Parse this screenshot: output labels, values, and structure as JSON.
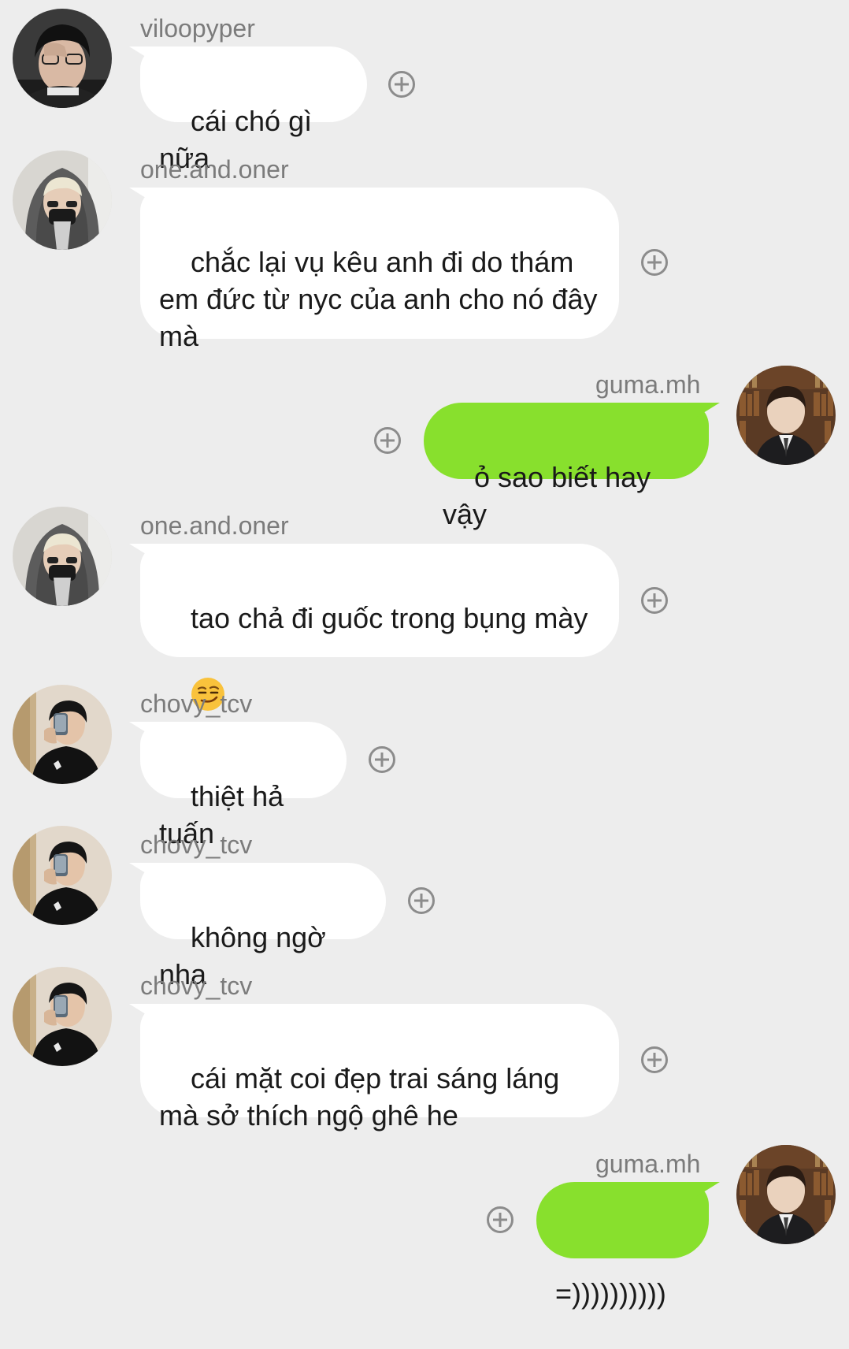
{
  "messages": [
    {
      "user": "viloopyper",
      "text": "cái chó gì nữa",
      "direction": "incoming",
      "avatar": "viloopyper-avatar"
    },
    {
      "user": "one.and.oner",
      "text": "chắc lại vụ kêu anh đi do thám em đức từ nyc của anh cho nó đây mà",
      "direction": "incoming",
      "avatar": "oner-avatar"
    },
    {
      "user": "guma.mh",
      "text": "ỏ sao biết hay vậy",
      "direction": "outgoing",
      "avatar": "guma-avatar"
    },
    {
      "user": "one.and.oner",
      "text": "tao chả đi guốc trong bụng mày",
      "emoji": "smirking-face",
      "direction": "incoming",
      "avatar": "oner-avatar"
    },
    {
      "user": "chovy_tcv",
      "text": "thiệt hả tuấn",
      "direction": "incoming",
      "avatar": "chovy-avatar"
    },
    {
      "user": "chovy_tcv",
      "text": "không ngờ nha",
      "direction": "incoming",
      "avatar": "chovy-avatar"
    },
    {
      "user": "chovy_tcv",
      "text": "cái mặt coi đẹp trai sáng láng mà sở thích ngộ ghê he",
      "direction": "incoming",
      "avatar": "chovy-avatar"
    },
    {
      "user": "guma.mh",
      "text": "=))))))))))",
      "direction": "outgoing",
      "avatar": "guma-avatar"
    }
  ],
  "colors": {
    "background": "#ededed",
    "incoming_bubble": "#ffffff",
    "outgoing_bubble": "#88e02d",
    "username": "#7b7b7b"
  },
  "icons": {
    "reaction": "add-reaction-icon"
  }
}
